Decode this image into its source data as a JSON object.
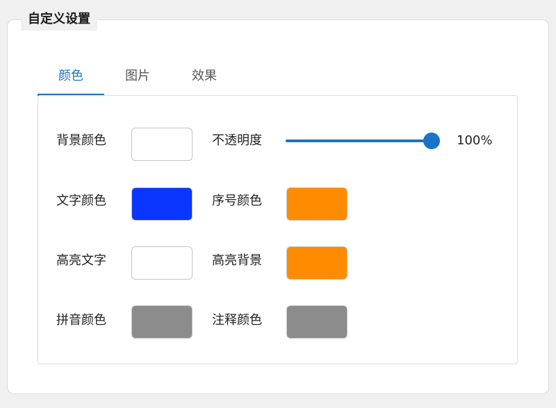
{
  "group": {
    "title": "自定义设置"
  },
  "tabs": [
    {
      "label": "颜色",
      "active": true
    },
    {
      "label": "图片",
      "active": false
    },
    {
      "label": "效果",
      "active": false
    }
  ],
  "colors": {
    "background": {
      "label": "背景颜色",
      "color": "#ffffff"
    },
    "text": {
      "label": "文字颜色",
      "color": "#0a36ff"
    },
    "highlight_text": {
      "label": "高亮文字",
      "color": "#ffffff"
    },
    "pinyin": {
      "label": "拼音颜色",
      "color": "#8c8c8c"
    },
    "index": {
      "label": "序号颜色",
      "color": "#ff8c00"
    },
    "highlight_background": {
      "label": "高亮背景",
      "color": "#ff8c00"
    },
    "comment": {
      "label": "注释颜色",
      "color": "#8c8c8c"
    }
  },
  "opacity": {
    "label": "不透明度",
    "value_text": "100%",
    "value": 100
  }
}
